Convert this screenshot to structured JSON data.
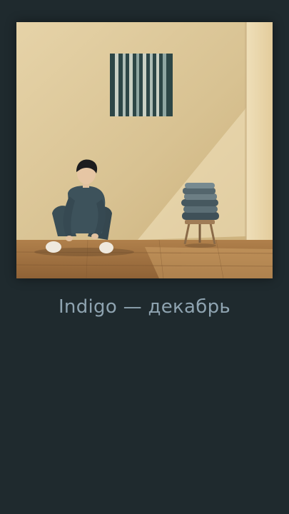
{
  "player": {
    "title": "Indigo — декабрь",
    "colors": {
      "background": "#1f2a2e",
      "caption": "#8ea3b0"
    }
  }
}
